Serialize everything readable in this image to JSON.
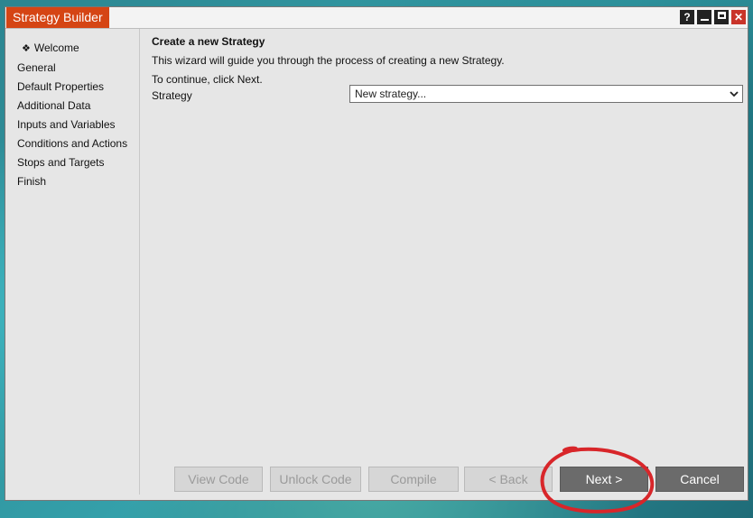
{
  "window": {
    "title": "Strategy Builder",
    "controls": {
      "help": "?",
      "close": "✕"
    }
  },
  "sidebar": {
    "items": [
      {
        "label": "Welcome",
        "active": true
      },
      {
        "label": "General"
      },
      {
        "label": "Default Properties"
      },
      {
        "label": "Additional Data"
      },
      {
        "label": "Inputs and Variables"
      },
      {
        "label": "Conditions and Actions"
      },
      {
        "label": "Stops and Targets"
      },
      {
        "label": "Finish"
      }
    ]
  },
  "main": {
    "heading": "Create a new Strategy",
    "description": "This wizard will guide you through the process of creating a new Strategy.",
    "instruction": "To continue, click Next.",
    "strategy_label": "Strategy",
    "strategy_value": "New strategy..."
  },
  "buttons": {
    "view_code": "View Code",
    "unlock_code": "Unlock Code",
    "compile": "Compile",
    "back": "< Back",
    "next": "Next >",
    "cancel": "Cancel"
  },
  "colors": {
    "title_accent": "#d54514",
    "annotation": "#d8262a",
    "primary_button": "#6b6b6b"
  }
}
